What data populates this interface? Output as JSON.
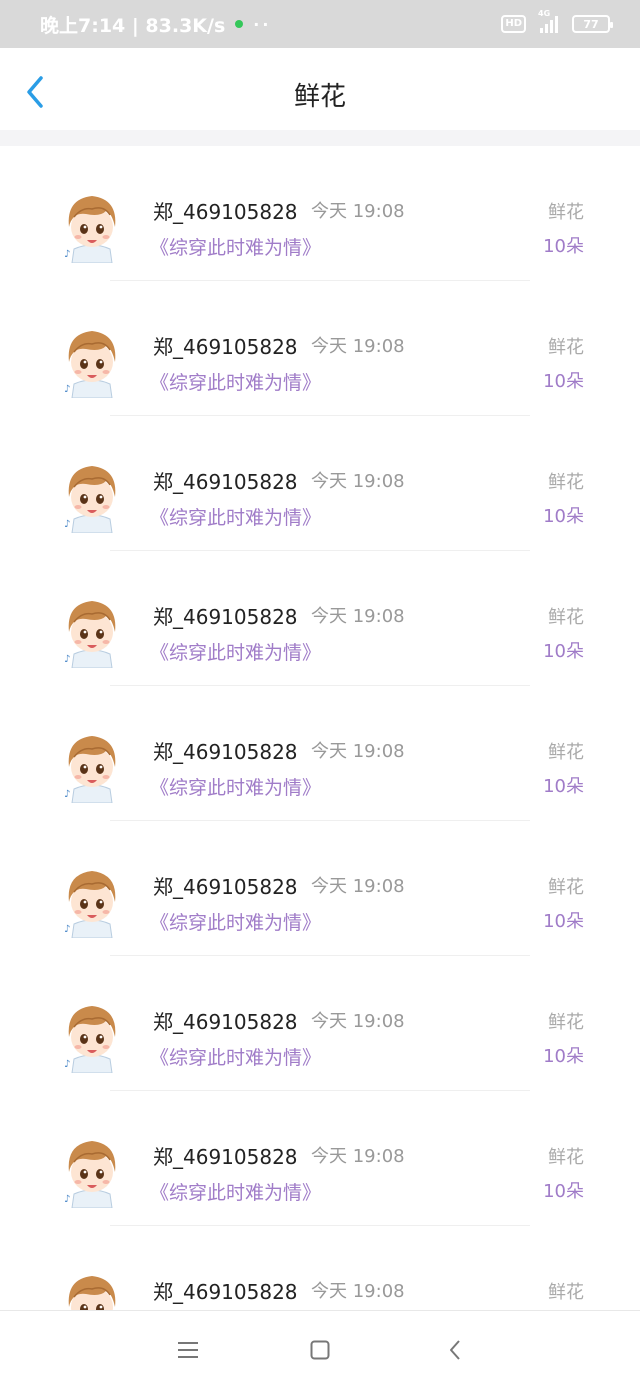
{
  "status_bar": {
    "time_speed": "晚上7:14 | 83.3K/s",
    "dots": "··",
    "hd": "HD",
    "network": "4G",
    "battery": "77"
  },
  "header": {
    "title": "鲜花"
  },
  "items": [
    {
      "username": "郑_469105828",
      "time": "今天 19:08",
      "book": "《综穿此时难为情》",
      "gift_type": "鲜花",
      "gift_count": "10朵"
    },
    {
      "username": "郑_469105828",
      "time": "今天 19:08",
      "book": "《综穿此时难为情》",
      "gift_type": "鲜花",
      "gift_count": "10朵"
    },
    {
      "username": "郑_469105828",
      "time": "今天 19:08",
      "book": "《综穿此时难为情》",
      "gift_type": "鲜花",
      "gift_count": "10朵"
    },
    {
      "username": "郑_469105828",
      "time": "今天 19:08",
      "book": "《综穿此时难为情》",
      "gift_type": "鲜花",
      "gift_count": "10朵"
    },
    {
      "username": "郑_469105828",
      "time": "今天 19:08",
      "book": "《综穿此时难为情》",
      "gift_type": "鲜花",
      "gift_count": "10朵"
    },
    {
      "username": "郑_469105828",
      "time": "今天 19:08",
      "book": "《综穿此时难为情》",
      "gift_type": "鲜花",
      "gift_count": "10朵"
    },
    {
      "username": "郑_469105828",
      "time": "今天 19:08",
      "book": "《综穿此时难为情》",
      "gift_type": "鲜花",
      "gift_count": "10朵"
    },
    {
      "username": "郑_469105828",
      "time": "今天 19:08",
      "book": "《综穿此时难为情》",
      "gift_type": "鲜花",
      "gift_count": "10朵"
    },
    {
      "username": "郑_469105828",
      "time": "今天 19:08",
      "book": "",
      "gift_type": "鲜花",
      "gift_count": ""
    }
  ],
  "colors": {
    "accent": "#a07cc8",
    "back_icon": "#2a9de6",
    "status_bar_bg": "#d9d9d9"
  },
  "icons": {
    "back": "chevron-left-icon",
    "menu": "menu-icon",
    "home": "home-square-icon",
    "nav_back": "nav-back-icon"
  }
}
